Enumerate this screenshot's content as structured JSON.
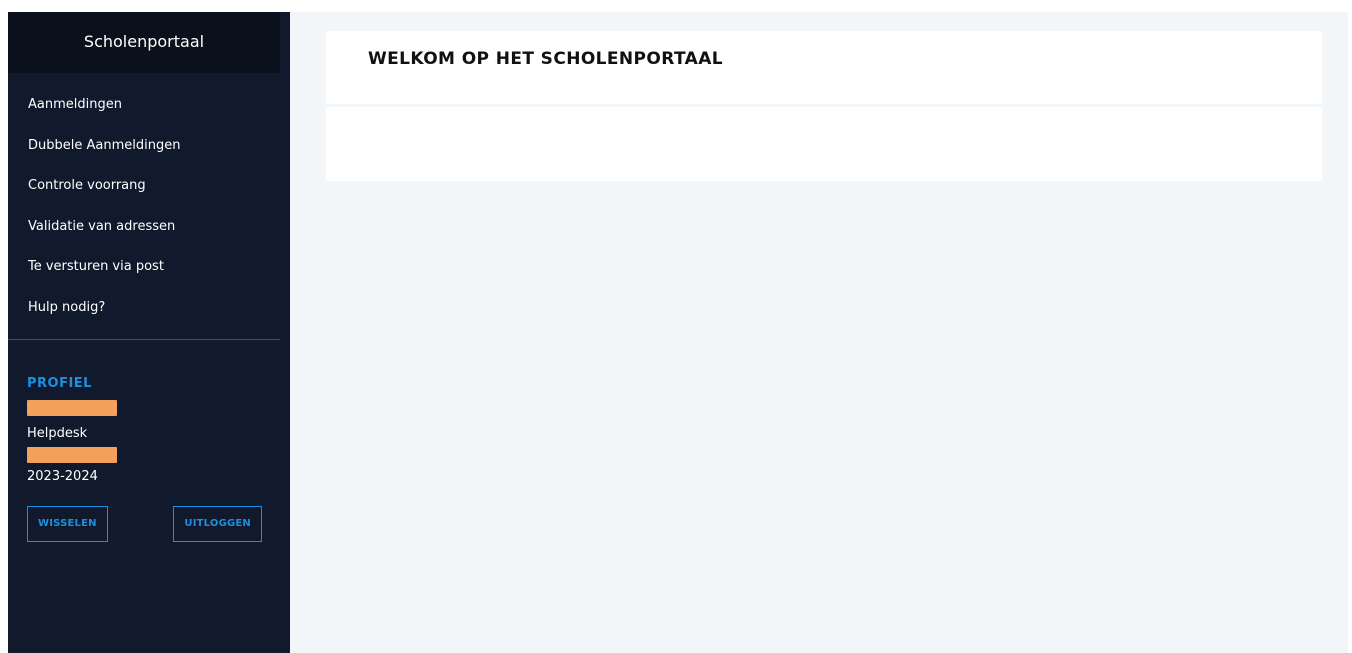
{
  "brand": {
    "title": "Scholenportaal"
  },
  "nav": {
    "items": [
      {
        "label": "Aanmeldingen"
      },
      {
        "label": "Dubbele Aanmeldingen"
      },
      {
        "label": "Controle voorrang"
      },
      {
        "label": "Validatie van adressen"
      },
      {
        "label": "Te versturen via post"
      },
      {
        "label": "Hulp nodig?"
      }
    ]
  },
  "profile": {
    "title": "PROFIEL",
    "role": "Helpdesk",
    "school_year": "2023-2024",
    "switch_label": "WISSELEN",
    "logout_label": "UITLOGGEN"
  },
  "main": {
    "welcome_title": "WELKOM OP HET SCHOLENPORTAAL"
  },
  "colors": {
    "sidebar": "#101a2c",
    "brand_bar": "#0b111c",
    "accent": "#1e8fe0",
    "redaction": "#f5a05a",
    "page_background": "#f3f6f9"
  }
}
